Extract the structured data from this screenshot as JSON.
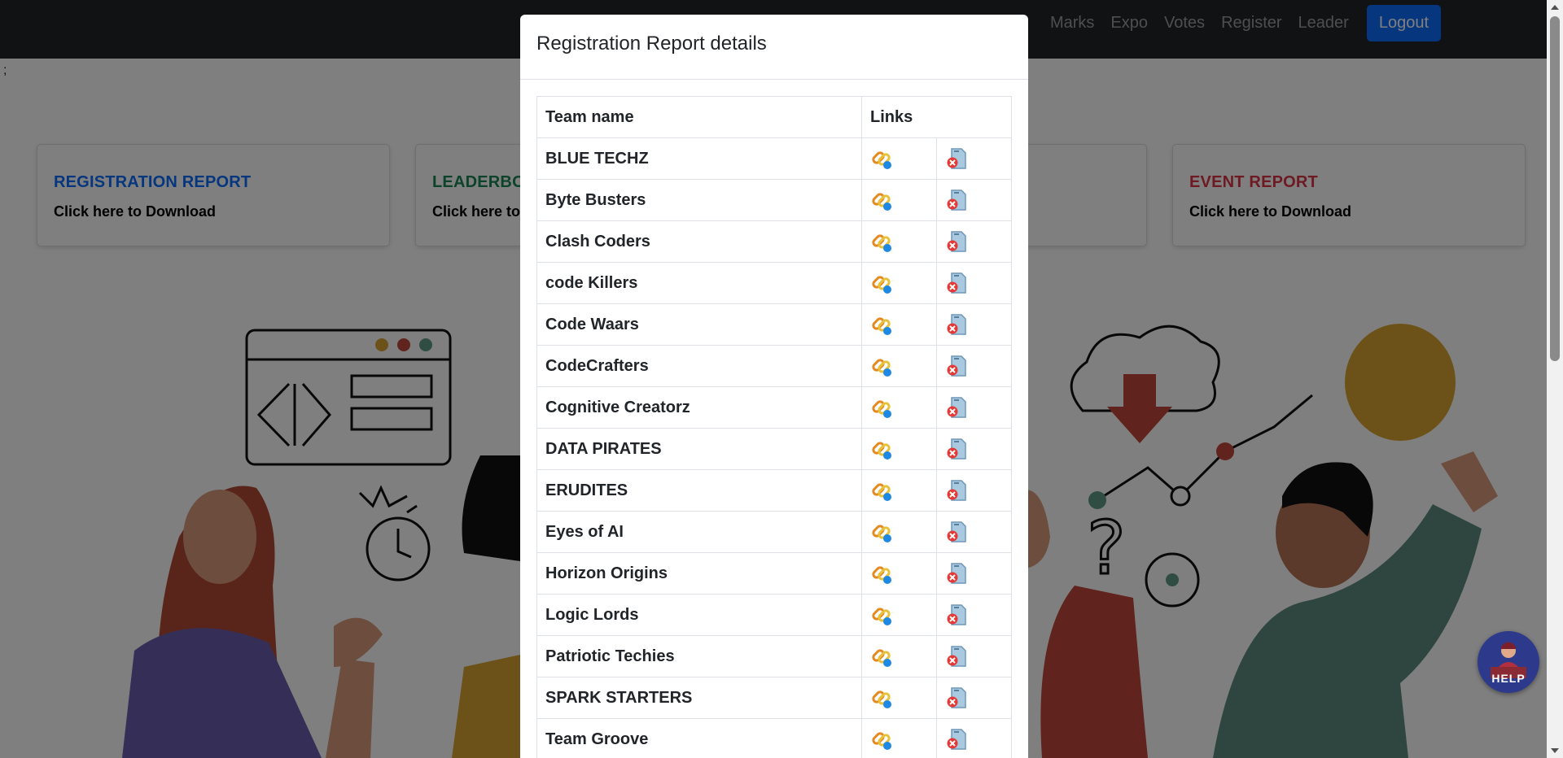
{
  "navbar": {
    "links": [
      "Marks",
      "Expo",
      "Votes",
      "Register",
      "Leader"
    ],
    "logout_label": "Logout"
  },
  "stray_text": ";",
  "cards": [
    {
      "title": "REGISTRATION REPORT",
      "subtitle": "Click here to Download",
      "color": "#0d6efd"
    },
    {
      "title": "LEADERBO",
      "subtitle": "Click here to",
      "color": "#198754"
    },
    {
      "title": "EVENT REPORT",
      "subtitle": "Click here to Download",
      "color": "#dc3545"
    }
  ],
  "modal": {
    "title": "Registration Report details",
    "columns": [
      "Team name",
      "Links"
    ],
    "rows": [
      {
        "team": "BLUE TECHZ"
      },
      {
        "team": "Byte Busters"
      },
      {
        "team": "Clash Coders"
      },
      {
        "team": "code Killers"
      },
      {
        "team": "Code Waars"
      },
      {
        "team": "CodeCrafters"
      },
      {
        "team": "Cognitive Creatorz"
      },
      {
        "team": "DATA PIRATES"
      },
      {
        "team": "ERUDITES"
      },
      {
        "team": "Eyes of AI"
      },
      {
        "team": "Horizon Origins"
      },
      {
        "team": "Logic Lords"
      },
      {
        "team": "Patriotic Techies"
      },
      {
        "team": "SPARK STARTERS"
      },
      {
        "team": "Team Groove"
      }
    ],
    "row_icons": [
      "link-icon",
      "delete-file-icon"
    ]
  },
  "help_button": {
    "label": "HELP",
    "icon": "receptionist-icon"
  },
  "colors": {
    "navbar": "#212529",
    "primary": "#0d6efd",
    "backdrop": "rgba(0,0,0,0.5)"
  }
}
